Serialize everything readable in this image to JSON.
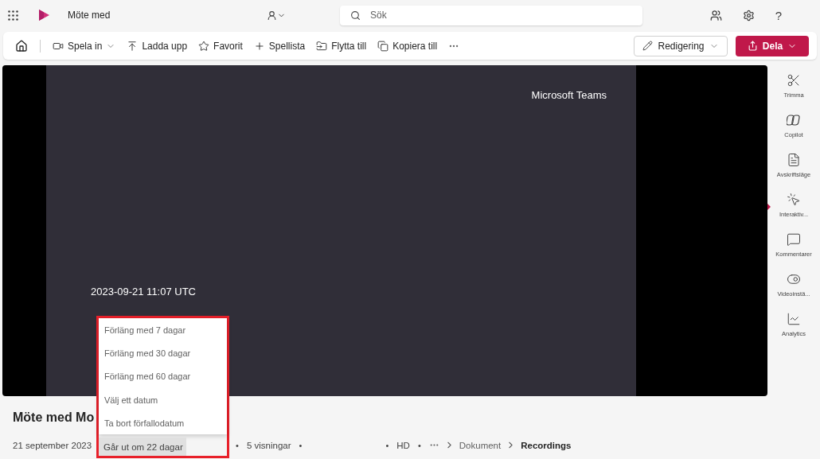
{
  "topbar": {
    "title": "Möte med",
    "search": {
      "placeholder": "Sök"
    },
    "help": "?"
  },
  "toolbar": {
    "items": [
      {
        "kind": "record",
        "label": "Spela in",
        "dropdown": true
      },
      {
        "kind": "upload",
        "label": "Ladda upp",
        "dropdown": false
      },
      {
        "kind": "star",
        "label": "Favorit",
        "dropdown": false
      },
      {
        "kind": "plus",
        "label": "Spellista",
        "dropdown": false
      },
      {
        "kind": "move",
        "label": "Flytta till",
        "dropdown": false
      },
      {
        "kind": "copy",
        "label": "Kopiera till",
        "dropdown": false
      }
    ],
    "edit": "Redigering",
    "share": "Dela"
  },
  "video": {
    "brand": "Microsoft Teams",
    "timestamp": "2023-09-21 11:07 UTC"
  },
  "rail": [
    {
      "kind": "trim",
      "label": "Trimma",
      "selected": false
    },
    {
      "kind": "copilot",
      "label": "Copilot",
      "selected": false
    },
    {
      "kind": "transcript",
      "label": "Avskriftsläge",
      "selected": false
    },
    {
      "kind": "interactive",
      "label": "Interaktiv...",
      "selected": true
    },
    {
      "kind": "comments",
      "label": "Kommentarer",
      "selected": false
    },
    {
      "kind": "settings",
      "label": "Videoinstä...",
      "selected": false
    },
    {
      "kind": "analytics",
      "label": "Analytics",
      "selected": false
    }
  ],
  "details": {
    "title": "Möte med Mo",
    "date": "21 september 2023",
    "expiry": "Går ut om 22 dagar",
    "meta": [
      {
        "kind": "dot",
        "text": "•"
      },
      {
        "kind": "text",
        "text": "5 visningar"
      },
      {
        "kind": "dot",
        "text": "•"
      },
      {
        "kind": "gap"
      },
      {
        "kind": "dot",
        "text": "•"
      },
      {
        "kind": "text",
        "text": "HD"
      },
      {
        "kind": "dot",
        "text": "•"
      }
    ],
    "breadcrumb": [
      {
        "label": "Dokument",
        "current": false
      },
      {
        "label": "Recordings",
        "current": true
      }
    ]
  },
  "expiry_menu": {
    "items": [
      "Förläng med 7 dagar",
      "Förläng med 30 dagar",
      "Förläng med 60 dagar",
      "Välj ett datum",
      "Ta bort förfallodatum"
    ]
  }
}
